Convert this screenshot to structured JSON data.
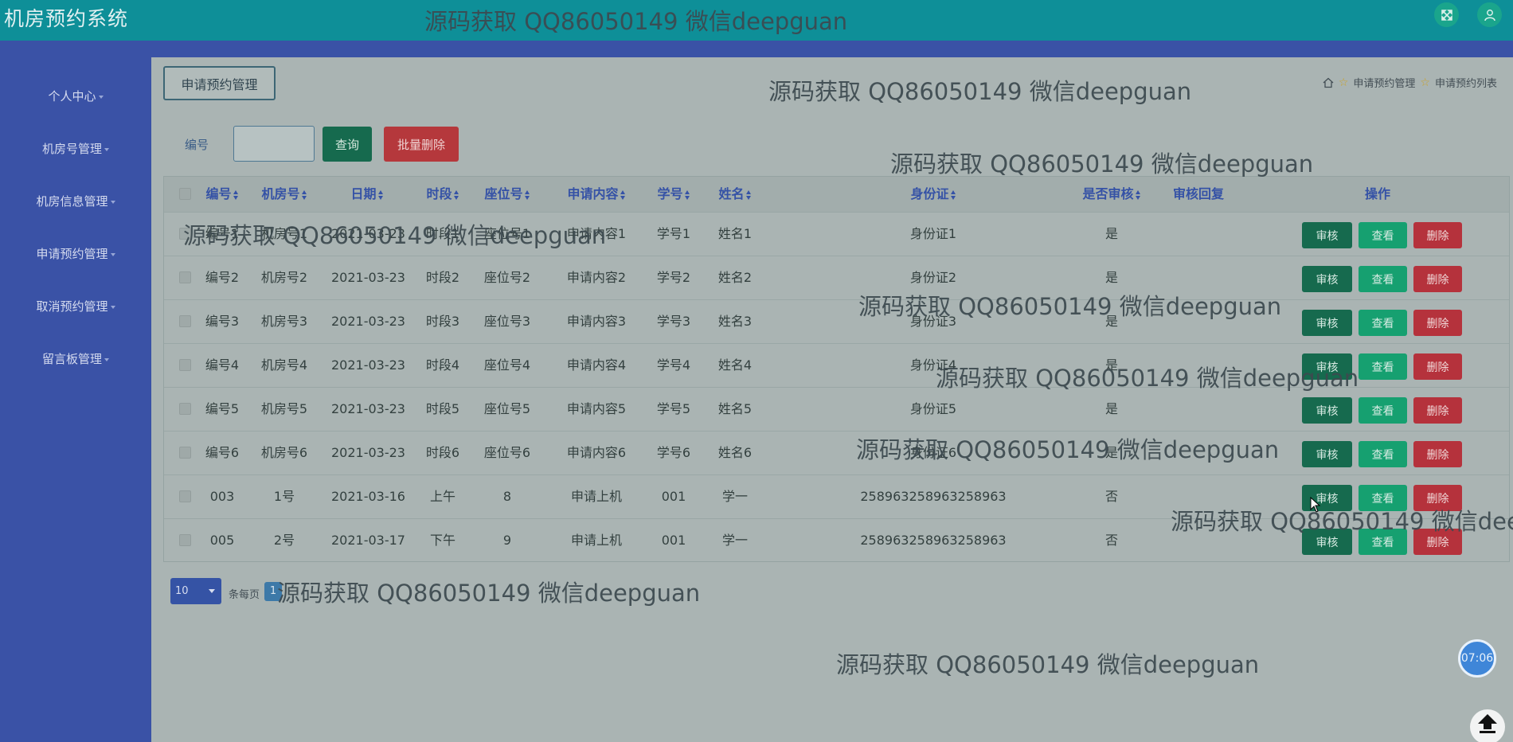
{
  "app": {
    "title": "机房预约系统"
  },
  "header": {
    "fullscreen_icon": "expand-arrows-icon",
    "user_icon": "user-icon"
  },
  "sidebar": {
    "items": [
      {
        "label": "个人中心"
      },
      {
        "label": "机房号管理"
      },
      {
        "label": "机房信息管理"
      },
      {
        "label": "申请预约管理"
      },
      {
        "label": "取消预约管理"
      },
      {
        "label": "留言板管理"
      }
    ]
  },
  "page": {
    "section_title": "申请预约管理",
    "breadcrumb": {
      "home_icon": "home-icon",
      "level1": "申请预约管理",
      "level2": "申请预约列表"
    }
  },
  "search": {
    "label": "编号",
    "value": "",
    "query_button": "查询",
    "batch_delete_button": "批量删除"
  },
  "table": {
    "columns": [
      "编号",
      "机房号",
      "日期",
      "时段",
      "座位号",
      "申请内容",
      "学号",
      "姓名",
      "身份证",
      "是否审核",
      "审核回复",
      "操作"
    ],
    "action_labels": {
      "audit": "审核",
      "view": "查看",
      "delete": "删除"
    },
    "rows": [
      {
        "id": "编号1",
        "room": "机房号1",
        "date": "2021-03-23",
        "period": "时段1",
        "seat": "座位号1",
        "content": "申请内容1",
        "student_no": "学号1",
        "name": "姓名1",
        "id_card": "身份证1",
        "audited": "是",
        "reply": ""
      },
      {
        "id": "编号2",
        "room": "机房号2",
        "date": "2021-03-23",
        "period": "时段2",
        "seat": "座位号2",
        "content": "申请内容2",
        "student_no": "学号2",
        "name": "姓名2",
        "id_card": "身份证2",
        "audited": "是",
        "reply": ""
      },
      {
        "id": "编号3",
        "room": "机房号3",
        "date": "2021-03-23",
        "period": "时段3",
        "seat": "座位号3",
        "content": "申请内容3",
        "student_no": "学号3",
        "name": "姓名3",
        "id_card": "身份证3",
        "audited": "是",
        "reply": ""
      },
      {
        "id": "编号4",
        "room": "机房号4",
        "date": "2021-03-23",
        "period": "时段4",
        "seat": "座位号4",
        "content": "申请内容4",
        "student_no": "学号4",
        "name": "姓名4",
        "id_card": "身份证4",
        "audited": "是",
        "reply": ""
      },
      {
        "id": "编号5",
        "room": "机房号5",
        "date": "2021-03-23",
        "period": "时段5",
        "seat": "座位号5",
        "content": "申请内容5",
        "student_no": "学号5",
        "name": "姓名5",
        "id_card": "身份证5",
        "audited": "是",
        "reply": ""
      },
      {
        "id": "编号6",
        "room": "机房号6",
        "date": "2021-03-23",
        "period": "时段6",
        "seat": "座位号6",
        "content": "申请内容6",
        "student_no": "学号6",
        "name": "姓名6",
        "id_card": "身份证6",
        "audited": "是",
        "reply": ""
      },
      {
        "id": "003",
        "room": "1号",
        "date": "2021-03-16",
        "period": "上午",
        "seat": "8",
        "content": "申请上机",
        "student_no": "001",
        "name": "学一",
        "id_card": "258963258963258963",
        "audited": "否",
        "reply": ""
      },
      {
        "id": "005",
        "room": "2号",
        "date": "2021-03-17",
        "period": "下午",
        "seat": "9",
        "content": "申请上机",
        "student_no": "001",
        "name": "学一",
        "id_card": "258963258963258963",
        "audited": "否",
        "reply": ""
      }
    ]
  },
  "pagination": {
    "page_size": "10",
    "page_size_label": "条每页",
    "current_page": "1"
  },
  "widgets": {
    "clock_time": "07:06",
    "back_to_top_icon": "arrow-up-icon"
  },
  "watermark": {
    "text": "源码获取 QQ86050149 微信deepguan"
  },
  "colors": {
    "topbar": "#0e8f98",
    "sidebar": "#3a52a6",
    "audit": "#166a4e",
    "view": "#16a070",
    "delete": "#b5323c"
  }
}
